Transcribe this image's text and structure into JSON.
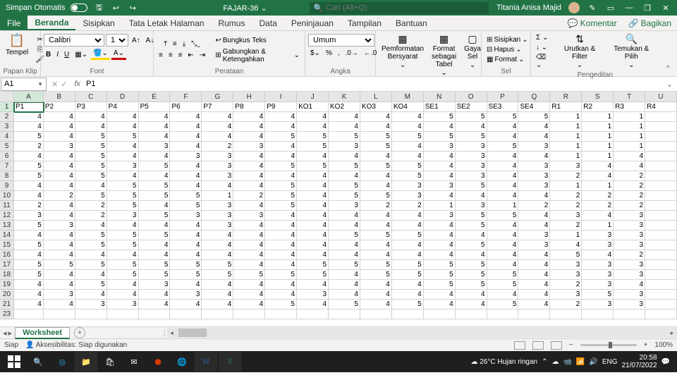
{
  "titlebar": {
    "autosave": "Simpan Otomatis",
    "filename": "FAJAR-36",
    "search_placeholder": "Cari (Alt+Q)",
    "username": "Titania Anisa Majid"
  },
  "tabs": {
    "file": "File",
    "items": [
      "Beranda",
      "Sisipkan",
      "Tata Letak Halaman",
      "Rumus",
      "Data",
      "Peninjauan",
      "Tampilan",
      "Bantuan"
    ],
    "comments": "Komentar",
    "share": "Bagikan"
  },
  "ribbon": {
    "clipboard": {
      "paste": "Tempel",
      "label": "Papan Klip"
    },
    "font": {
      "name": "Calibri",
      "size": "11",
      "label": "Font"
    },
    "align": {
      "wrap": "Bungkus Teks",
      "merge": "Gabungkan & Ketengahkan",
      "label": "Perataan"
    },
    "number": {
      "format": "Umum",
      "label": "Angka"
    },
    "styles": {
      "cond": "Pemformatan Bersyarat",
      "table": "Format sebagai Tabel",
      "cell": "Gaya Sel",
      "label": "Gaya"
    },
    "cells": {
      "insert": "Sisipkan",
      "delete": "Hapus",
      "format": "Format",
      "label": "Sel"
    },
    "editing": {
      "sort": "Urutkan & Filter",
      "find": "Temukan & Pilih",
      "label": "Pengeditan"
    }
  },
  "fbar": {
    "name": "A1",
    "formula": "P1"
  },
  "cols": [
    "A",
    "B",
    "C",
    "D",
    "E",
    "F",
    "G",
    "H",
    "I",
    "J",
    "K",
    "L",
    "M",
    "N",
    "O",
    "P",
    "Q",
    "R",
    "S",
    "T",
    "U"
  ],
  "headers": [
    "P1",
    "P2",
    "P3",
    "P4",
    "P5",
    "P6",
    "P7",
    "P8",
    "P9",
    "KO1",
    "KO2",
    "KO3",
    "KO4",
    "SE1",
    "SE2",
    "SE3",
    "SE4",
    "R1",
    "R2",
    "R3",
    "R4"
  ],
  "rows": [
    [
      4,
      4,
      4,
      4,
      4,
      4,
      4,
      4,
      4,
      4,
      4,
      4,
      4,
      5,
      5,
      5,
      5,
      1,
      1,
      1,
      ""
    ],
    [
      4,
      4,
      4,
      4,
      4,
      4,
      4,
      4,
      4,
      4,
      4,
      4,
      4,
      4,
      4,
      4,
      4,
      1,
      1,
      1,
      ""
    ],
    [
      5,
      4,
      5,
      5,
      4,
      4,
      4,
      4,
      5,
      5,
      5,
      5,
      5,
      5,
      5,
      4,
      4,
      1,
      1,
      1,
      ""
    ],
    [
      2,
      3,
      5,
      4,
      3,
      4,
      2,
      3,
      4,
      5,
      3,
      5,
      4,
      3,
      3,
      5,
      3,
      1,
      1,
      1,
      ""
    ],
    [
      4,
      4,
      5,
      4,
      4,
      3,
      3,
      4,
      4,
      4,
      4,
      4,
      4,
      4,
      3,
      4,
      4,
      1,
      1,
      4,
      ""
    ],
    [
      5,
      4,
      5,
      3,
      5,
      4,
      3,
      4,
      5,
      5,
      5,
      5,
      5,
      4,
      3,
      4,
      3,
      3,
      4,
      4,
      ""
    ],
    [
      5,
      4,
      5,
      4,
      4,
      4,
      3,
      4,
      4,
      4,
      4,
      4,
      5,
      4,
      3,
      4,
      3,
      2,
      4,
      2,
      ""
    ],
    [
      4,
      4,
      4,
      5,
      5,
      4,
      4,
      4,
      5,
      4,
      5,
      4,
      3,
      3,
      5,
      4,
      3,
      1,
      1,
      2,
      ""
    ],
    [
      4,
      2,
      5,
      5,
      5,
      5,
      1,
      2,
      5,
      4,
      5,
      5,
      3,
      4,
      4,
      4,
      4,
      2,
      2,
      2,
      ""
    ],
    [
      2,
      4,
      2,
      5,
      4,
      5,
      3,
      4,
      5,
      4,
      3,
      2,
      2,
      1,
      3,
      1,
      2,
      2,
      2,
      2,
      ""
    ],
    [
      3,
      4,
      2,
      3,
      5,
      3,
      3,
      3,
      4,
      4,
      4,
      4,
      4,
      3,
      5,
      5,
      4,
      3,
      4,
      3,
      ""
    ],
    [
      5,
      3,
      4,
      4,
      4,
      4,
      3,
      4,
      4,
      4,
      4,
      4,
      4,
      4,
      5,
      4,
      4,
      2,
      1,
      3,
      ""
    ],
    [
      4,
      4,
      5,
      5,
      5,
      4,
      4,
      4,
      4,
      4,
      5,
      5,
      5,
      4,
      4,
      4,
      3,
      1,
      3,
      3,
      ""
    ],
    [
      5,
      4,
      5,
      5,
      4,
      4,
      4,
      4,
      4,
      4,
      4,
      4,
      4,
      4,
      5,
      4,
      3,
      4,
      3,
      3,
      ""
    ],
    [
      4,
      4,
      4,
      4,
      4,
      4,
      4,
      4,
      4,
      4,
      4,
      4,
      4,
      4,
      4,
      4,
      4,
      5,
      4,
      2,
      ""
    ],
    [
      5,
      5,
      5,
      5,
      5,
      5,
      5,
      4,
      4,
      5,
      5,
      5,
      5,
      5,
      5,
      4,
      4,
      3,
      3,
      3,
      ""
    ],
    [
      5,
      4,
      4,
      5,
      5,
      5,
      5,
      5,
      5,
      5,
      4,
      5,
      5,
      5,
      5,
      5,
      4,
      3,
      3,
      3,
      ""
    ],
    [
      4,
      4,
      5,
      4,
      3,
      4,
      4,
      4,
      4,
      4,
      4,
      4,
      4,
      5,
      5,
      5,
      4,
      2,
      3,
      4,
      ""
    ],
    [
      4,
      3,
      4,
      4,
      4,
      3,
      4,
      4,
      4,
      3,
      4,
      4,
      4,
      4,
      4,
      4,
      4,
      3,
      5,
      3,
      ""
    ],
    [
      4,
      4,
      3,
      3,
      4,
      4,
      4,
      4,
      5,
      4,
      5,
      4,
      5,
      4,
      4,
      5,
      4,
      2,
      3,
      3,
      ""
    ]
  ],
  "sheet": {
    "name": "Worksheet"
  },
  "status": {
    "ready": "Siap",
    "acc": "Aksesibilitas: Siap digunakan",
    "zoom": "100%"
  },
  "taskbar": {
    "weather": "26°C  Hujan ringan",
    "time": "20:58",
    "date": "21/07/2022"
  }
}
